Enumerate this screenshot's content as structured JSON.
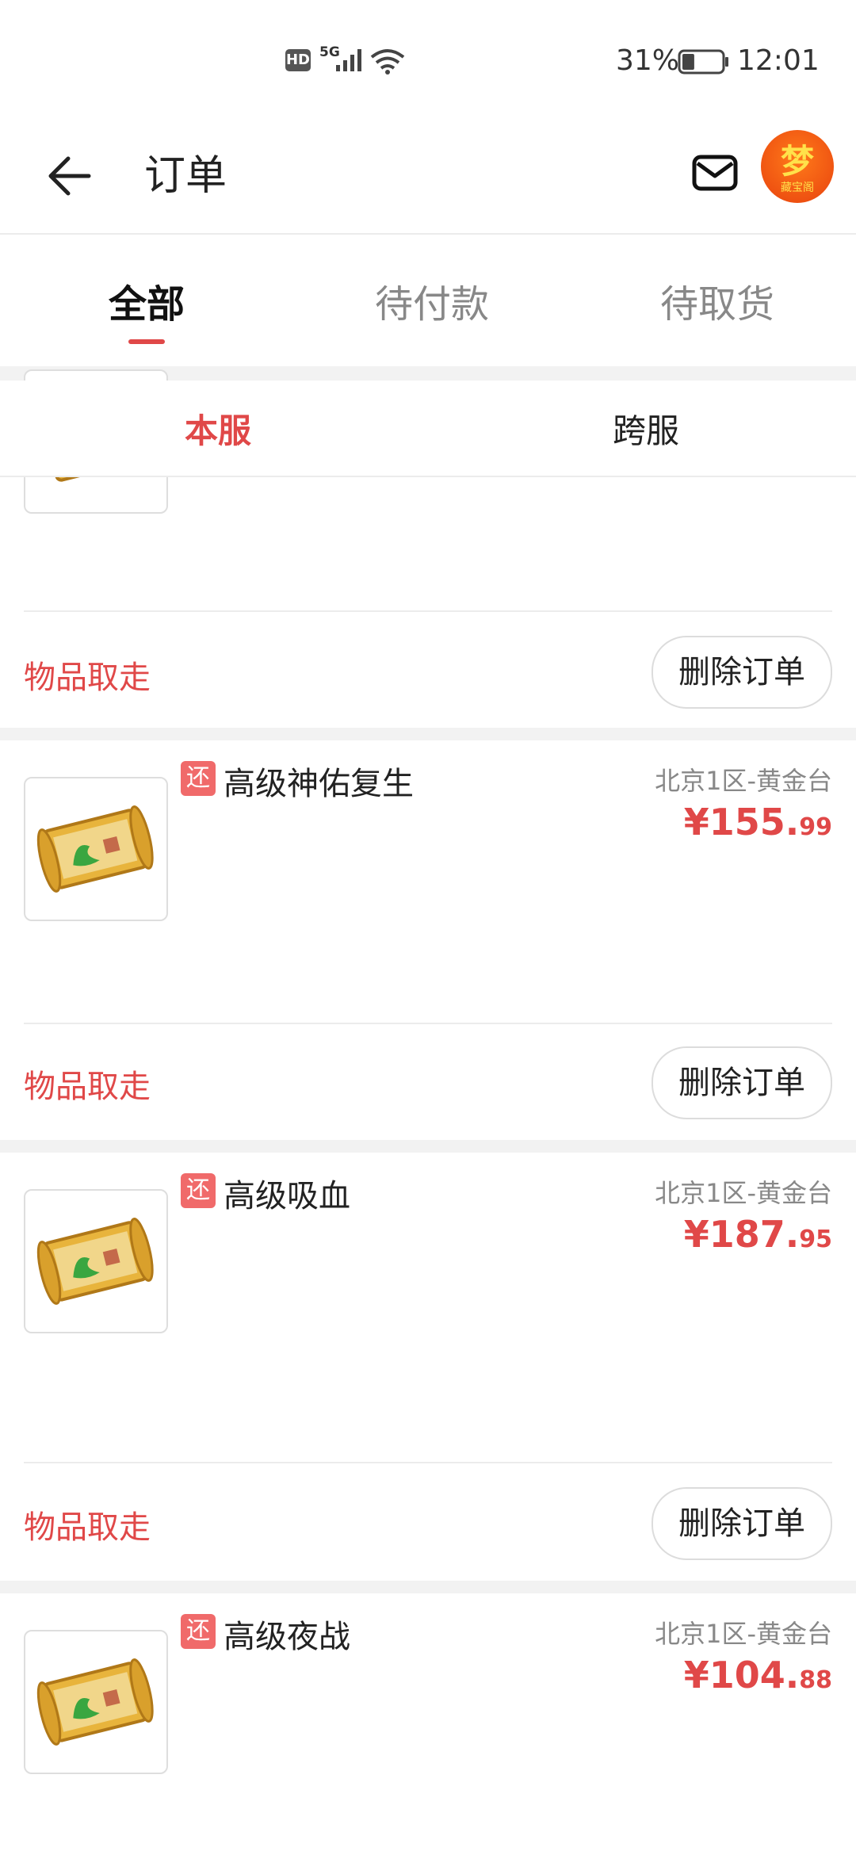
{
  "status_bar": {
    "hd": "HD",
    "network": "5G",
    "battery_pct": "31%",
    "battery_level": 0.31,
    "time": "12:01"
  },
  "header": {
    "title": "订单",
    "back_icon": "arrow-left-icon",
    "mail_icon": "mail-icon",
    "avatar_glyph": "梦",
    "avatar_sub": "藏宝阁"
  },
  "tabs": [
    {
      "label": "全部",
      "active": true
    },
    {
      "label": "待付款",
      "active": false
    },
    {
      "label": "待取货",
      "active": false
    }
  ],
  "sub_tabs": [
    {
      "label": "本服",
      "active": true
    },
    {
      "label": "跨服",
      "active": false
    }
  ],
  "colors": {
    "accent": "#e04848",
    "tag_bg": "#f06a6a",
    "divider": "#ececec",
    "gap": "#f2f2f2"
  },
  "orders": [
    {
      "status": "物品取走",
      "action": "删除订单"
    },
    {
      "tag": "还",
      "name": "高级神佑复生",
      "server": "北京1区-黄金台",
      "price_int": "¥155.",
      "price_dec": "99",
      "status": "物品取走",
      "action": "删除订单"
    },
    {
      "tag": "还",
      "name": "高级吸血",
      "server": "北京1区-黄金台",
      "price_int": "¥187.",
      "price_dec": "95",
      "status": "物品取走",
      "action": "删除订单"
    },
    {
      "tag": "还",
      "name": "高级夜战",
      "server": "北京1区-黄金台",
      "price_int": "¥104.",
      "price_dec": "88"
    }
  ]
}
